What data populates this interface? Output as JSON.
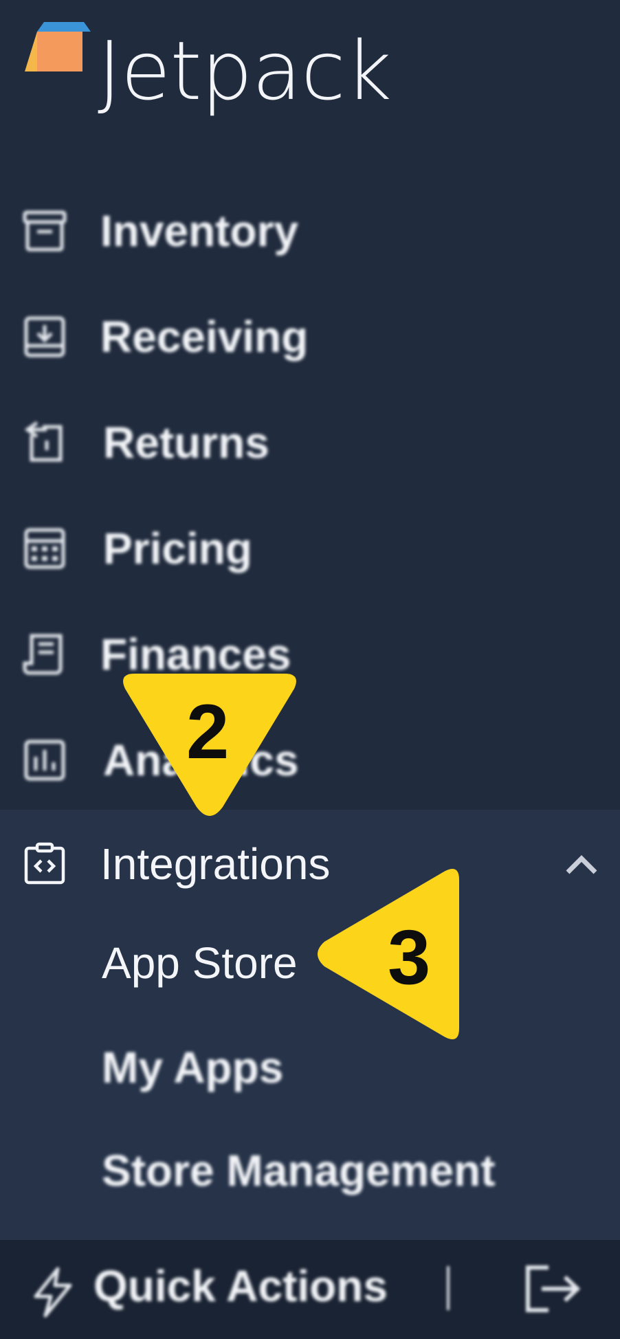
{
  "brand": {
    "name": "Jetpack",
    "mark_colors": {
      "orange": "#f39a5c",
      "blue": "#3b93d8",
      "yellow": "#f5b64a"
    }
  },
  "nav": {
    "items": [
      {
        "label": "Inventory",
        "icon": "archive-box-icon"
      },
      {
        "label": "Receiving",
        "icon": "tray-download-icon"
      },
      {
        "label": "Returns",
        "icon": "return-arrow-icon"
      },
      {
        "label": "Pricing",
        "icon": "calculator-icon"
      },
      {
        "label": "Finances",
        "icon": "receipt-icon"
      },
      {
        "label": "Analytics",
        "icon": "bar-chart-icon"
      }
    ],
    "integrations": {
      "label": "Integrations",
      "icon": "code-clipboard-icon",
      "expanded": true,
      "children": [
        {
          "label": "App Store"
        },
        {
          "label": "My Apps"
        },
        {
          "label": "Store Management"
        }
      ]
    }
  },
  "footer": {
    "quick_actions_label": "Quick Actions",
    "quick_actions_icon": "lightning-icon",
    "logout_icon": "logout-icon"
  },
  "annotations": {
    "marker_2": "2",
    "marker_3": "3",
    "color": "#fcd419"
  },
  "colors": {
    "sidebar_bg": "#202b3d",
    "expanded_bg": "#263349",
    "footer_bg": "#1a2333",
    "text": "#f3f5f8"
  }
}
